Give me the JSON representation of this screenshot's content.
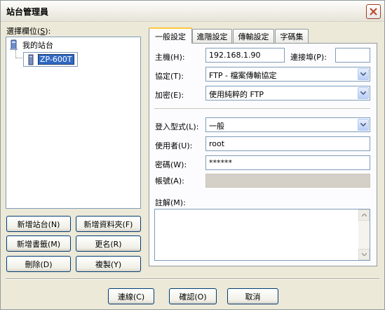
{
  "window": {
    "title": "站台管理員"
  },
  "left": {
    "label": "選擇欄位(",
    "label_key": "S",
    "label_end": "):",
    "tree": {
      "root": "我的站台",
      "child": "ZP-600T"
    },
    "buttons": {
      "new_site": "新增站台(N)",
      "new_folder": "新增資料夾(F)",
      "new_bookmark": "新增書籤(M)",
      "rename": "更名(R)",
      "delete": "刪除(D)",
      "copy": "複製(Y)"
    }
  },
  "tabs": [
    "一般設定",
    "進階設定",
    "傳輸設定",
    "字碼集"
  ],
  "general": {
    "host_label": "主機(H):",
    "host_value": "192.168.1.90",
    "port_label": "連接埠(P):",
    "port_value": "",
    "protocol_label": "協定(T):",
    "protocol_value": "FTP - 檔案傳輸協定",
    "encryption_label": "加密(E):",
    "encryption_value": "使用純粹的 FTP",
    "logon_label": "登入型式(L):",
    "logon_value": "一般",
    "user_label": "使用者(U):",
    "user_value": "root",
    "password_label": "密碼(W):",
    "password_value": "******",
    "account_label": "帳號(A):",
    "account_value": "",
    "comments_label": "註解(M):"
  },
  "footer": {
    "connect": "連線(C)",
    "ok": "確認(O)",
    "cancel": "取消"
  }
}
